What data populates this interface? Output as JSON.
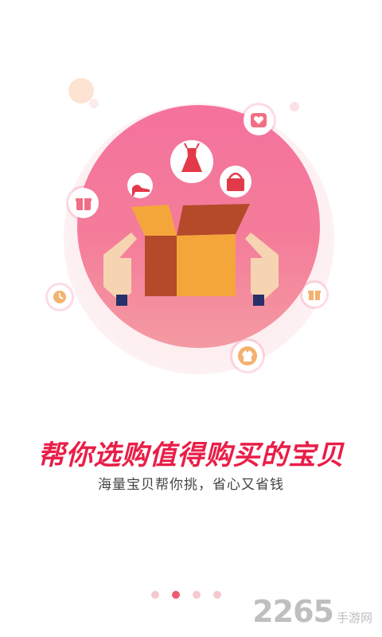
{
  "onboarding": {
    "headline": "帮你选购值得购买的宝贝",
    "subline": "海量宝贝帮你挑，省心又省钱",
    "pager": {
      "total": 4,
      "active_index": 1
    }
  },
  "watermark": {
    "number": "2265",
    "suffix": "手游网"
  },
  "colors": {
    "accent": "#e91e48",
    "circle_top": "#f4729c",
    "circle_bottom": "#f49aa2",
    "box_front": "#f5a63a",
    "box_side": "#b44a2a",
    "pager_active": "#ef5c6f",
    "pager_inactive": "#f6c9cf"
  },
  "icons": [
    "dress-icon",
    "high-heel-icon",
    "handbag-icon",
    "heart-icon",
    "gift-icon",
    "clock-icon",
    "gift-box-icon",
    "jacket-icon",
    "open-box-icon",
    "hand-icon"
  ]
}
